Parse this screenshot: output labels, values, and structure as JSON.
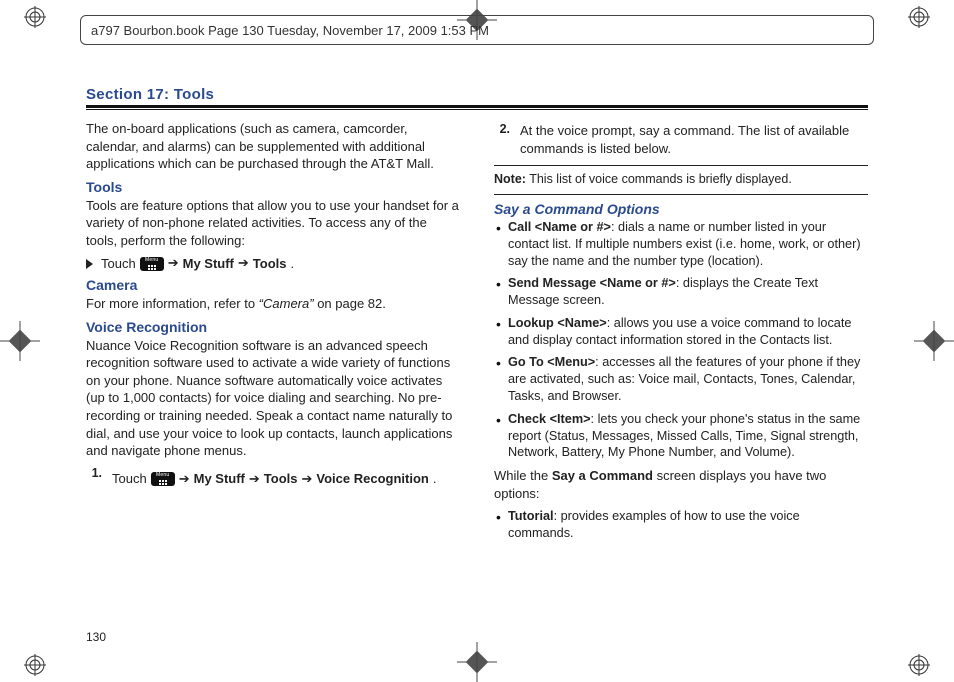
{
  "header": {
    "text": "a797 Bourbon.book  Page 130  Tuesday, November 17, 2009  1:53 PM"
  },
  "section": {
    "title": "Section 17: Tools",
    "intro": "The on-board applications (such as camera, camcorder, calendar, and alarms) can be supplemented with additional applications which can be purchased through the AT&T Mall."
  },
  "tools": {
    "heading": "Tools",
    "body": "Tools are feature options that allow you to use your handset for a variety of non-phone related activities. To access any of the tools, perform the following:",
    "touch_word": "Touch",
    "arrow": "➔",
    "path1": "My Stuff",
    "path2": "Tools",
    "period": "."
  },
  "camera": {
    "heading": "Camera",
    "body_prefix": "For more information, refer to ",
    "body_italic": "“Camera”",
    "body_suffix": "  on page 82."
  },
  "voice": {
    "heading": "Voice Recognition",
    "body": "Nuance Voice Recognition software is an advanced speech recognition software used to activate a wide variety of functions on your phone. Nuance software automatically voice activates (up to 1,000 contacts) for voice dialing and searching. No pre-recording or training needed. Speak a contact name naturally to dial, and use your voice to look up contacts, launch applications and navigate phone menus.",
    "step1_num": "1.",
    "step1_touch": "Touch",
    "step1_arrow": "➔",
    "step1_a": "My Stuff",
    "step1_b": "Tools",
    "step1_c": "Voice Recognition",
    "period": "."
  },
  "right": {
    "step2_num": "2.",
    "step2_text": "At the voice prompt, say a command. The list of available commands is listed below.",
    "note_label": "Note:",
    "note_text": " This list of voice commands is briefly displayed.",
    "say_heading": "Say a Command Options",
    "items": [
      {
        "b": "Call <Name or #>",
        "t": ": dials a name or number listed in your contact list. If multiple numbers exist (i.e. home, work, or other) say the name and the number type (location)."
      },
      {
        "b": "Send Message <Name or #>",
        "t": ": displays the Create Text Message screen."
      },
      {
        "b": "Lookup <Name>",
        "t": ": allows you use a voice command to locate and display contact information stored in the Contacts list."
      },
      {
        "b": "Go To <Menu>",
        "t": ": accesses all the features of your phone if they are activated, such as: Voice mail, Contacts, Tones, Calendar, Tasks, and Browser."
      },
      {
        "b": "Check <Item>",
        "t": ": lets you check your phone's status in the same report (Status, Messages, Missed Calls, Time, Signal strength, Network, Battery, My Phone Number, and Volume)."
      }
    ],
    "while_prefix": "While the ",
    "while_bold": "Say a Command",
    "while_suffix": " screen displays you have two options:",
    "tutorial_b": "Tutorial",
    "tutorial_t": ": provides examples of how to use the voice commands."
  },
  "page_number": "130"
}
